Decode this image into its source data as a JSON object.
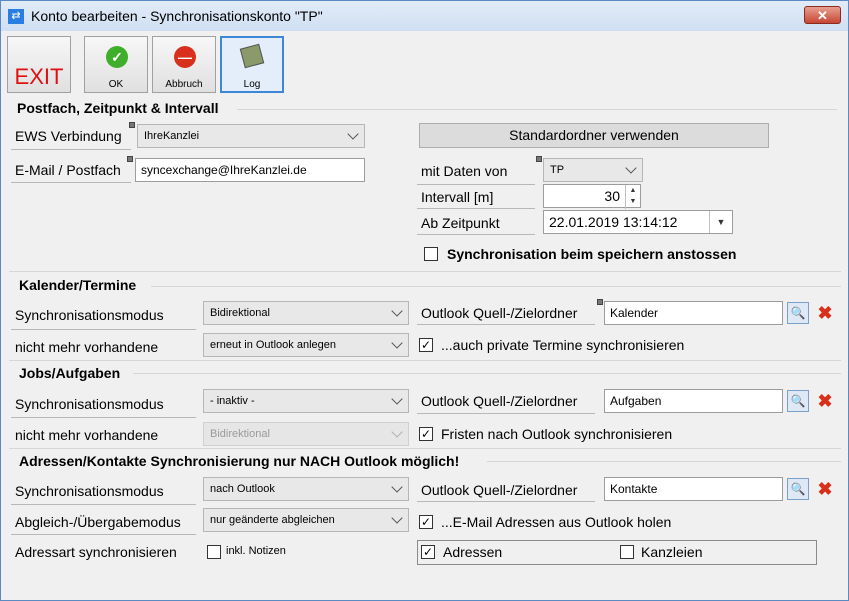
{
  "window": {
    "title": "Konto bearbeiten - Synchronisationskonto \"TP\"",
    "close": "✕"
  },
  "toolbar": {
    "exit": "EXIT",
    "ok": "OK",
    "abbruch": "Abbruch",
    "log": "Log"
  },
  "postfach": {
    "title": "Postfach, Zeitpunkt & Intervall",
    "ews_label": "EWS Verbindung",
    "ews_value": "IhreKanzlei",
    "email_label": "E-Mail / Postfach",
    "email_value": "syncexchange@IhreKanzlei.de",
    "standard_btn": "Standardordner verwenden",
    "mitdaten_label": "mit Daten von",
    "mitdaten_value": "TP",
    "intervall_label": "Intervall [m]",
    "intervall_value": "30",
    "zeitpunkt_label": "Ab Zeitpunkt",
    "zeitpunkt_value": "22.01.2019 13:14:12",
    "sync_save_label": "Synchronisation beim speichern anstossen",
    "sync_save_checked": false
  },
  "kalender": {
    "title": "Kalender/Termine",
    "modus_label": "Synchronisationsmodus",
    "modus_value": "Bidirektional",
    "nicht_label": "nicht mehr vorhandene",
    "nicht_value": "erneut in Outlook anlegen",
    "ordner_label": "Outlook Quell-/Zielordner",
    "ordner_value": "Kalender",
    "private_label": "...auch private Termine synchronisieren",
    "private_checked": true
  },
  "jobs": {
    "title": "Jobs/Aufgaben",
    "modus_label": "Synchronisationsmodus",
    "modus_value": "- inaktiv -",
    "nicht_label": "nicht mehr vorhandene",
    "nicht_value": "Bidirektional",
    "ordner_label": "Outlook Quell-/Zielordner",
    "ordner_value": "Aufgaben",
    "fristen_label": "Fristen nach Outlook synchronisieren",
    "fristen_checked": true
  },
  "adressen": {
    "title": "Adressen/Kontakte Synchronisierung nur NACH Outlook möglich!",
    "modus_label": "Synchronisationsmodus",
    "modus_value": "nach Outlook",
    "abgleich_label": "Abgleich-/Übergabemodus",
    "abgleich_value": "nur geänderte abgleichen",
    "art_label": "Adressart synchronisieren",
    "notizen_label": "inkl. Notizen",
    "notizen_checked": false,
    "ordner_label": "Outlook Quell-/Zielordner",
    "ordner_value": "Kontakte",
    "email_label": "...E-Mail Adressen aus Outlook holen",
    "email_checked": true,
    "adressen_label": "Adressen",
    "adressen_checked": true,
    "kanzleien_label": "Kanzleien",
    "kanzleien_checked": false
  },
  "glyphs": {
    "check": "✓",
    "search": "🔍",
    "delete": "✖",
    "up": "▲",
    "down": "▼"
  },
  "colors": {
    "accent": "#3c88d6",
    "exit": "#e01010",
    "delete": "#d8301c",
    "ok": "#3fae2a",
    "cancel": "#d8301c"
  }
}
